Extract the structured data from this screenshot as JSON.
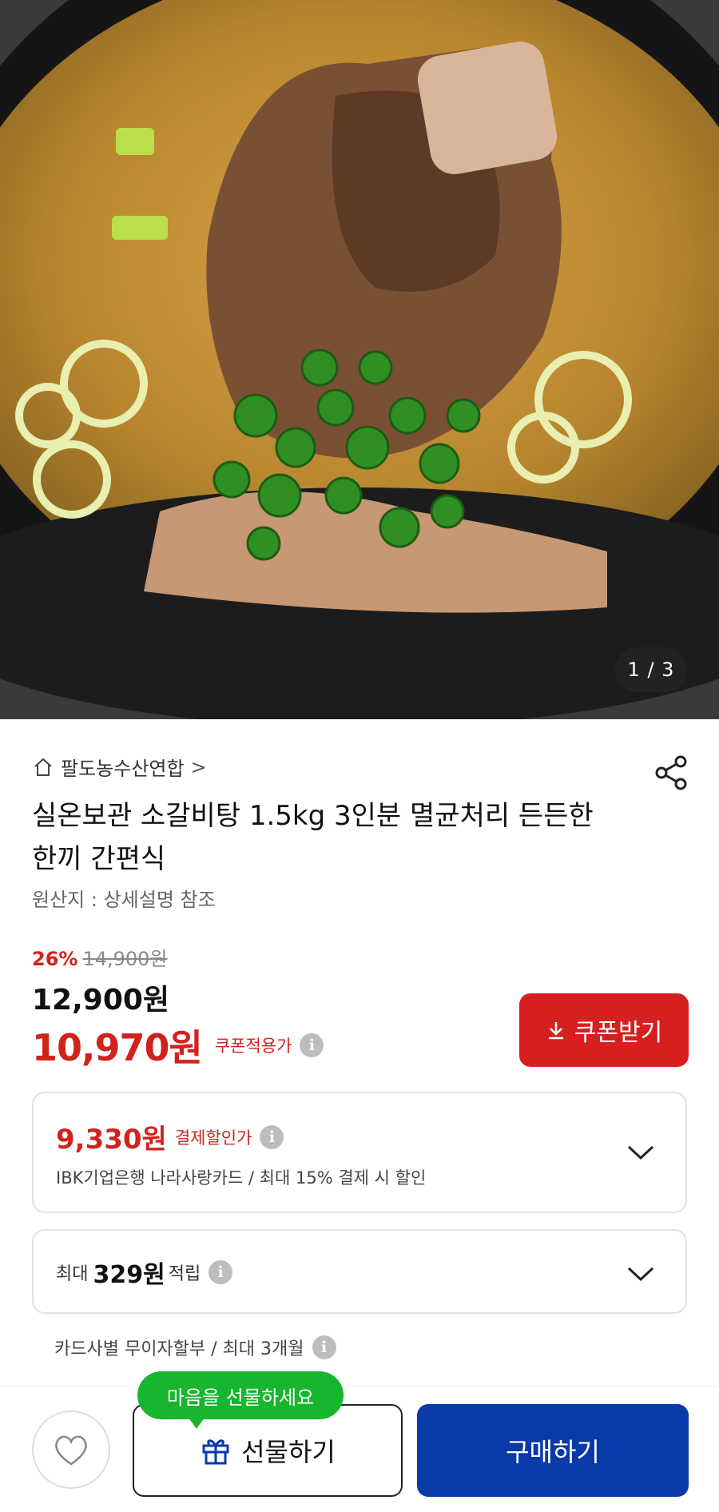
{
  "gallery": {
    "indicator": "1 / 3"
  },
  "store": {
    "name": "팔도농수산연합",
    "chevron": ">"
  },
  "product": {
    "title": "실온보관 소갈비탕 1.5kg 3인분 멸균처리 든든한 한끼 간편식",
    "origin": "원산지 : 상세설명 참조",
    "discount_percent": "26%",
    "original_price": "14,900원",
    "price": "12,900원",
    "coupon_price": "10,970원",
    "coupon_price_label": "쿠폰적용가"
  },
  "coupon_button": {
    "label": "쿠폰받기"
  },
  "payment_discount": {
    "price": "9,330원",
    "label": "결제할인가",
    "detail": "IBK기업은행 나라사랑카드 / 최대 15% 결제 시 할인"
  },
  "points": {
    "prefix": "최대",
    "amount": "329원",
    "suffix": "적립"
  },
  "installment": {
    "text": "카드사별 무이자할부 / 최대 3개월"
  },
  "bottom_bar": {
    "tooltip": "마음을 선물하세요",
    "gift_label": "선물하기",
    "buy_label": "구매하기"
  },
  "colors": {
    "accent_red": "#d71f1f",
    "buy_blue": "#0a3aa8",
    "tooltip_green": "#18b52e"
  },
  "icons": [
    "home-icon",
    "share-icon",
    "info-icon",
    "download-icon",
    "chevron-down-icon",
    "heart-icon",
    "gift-icon"
  ]
}
